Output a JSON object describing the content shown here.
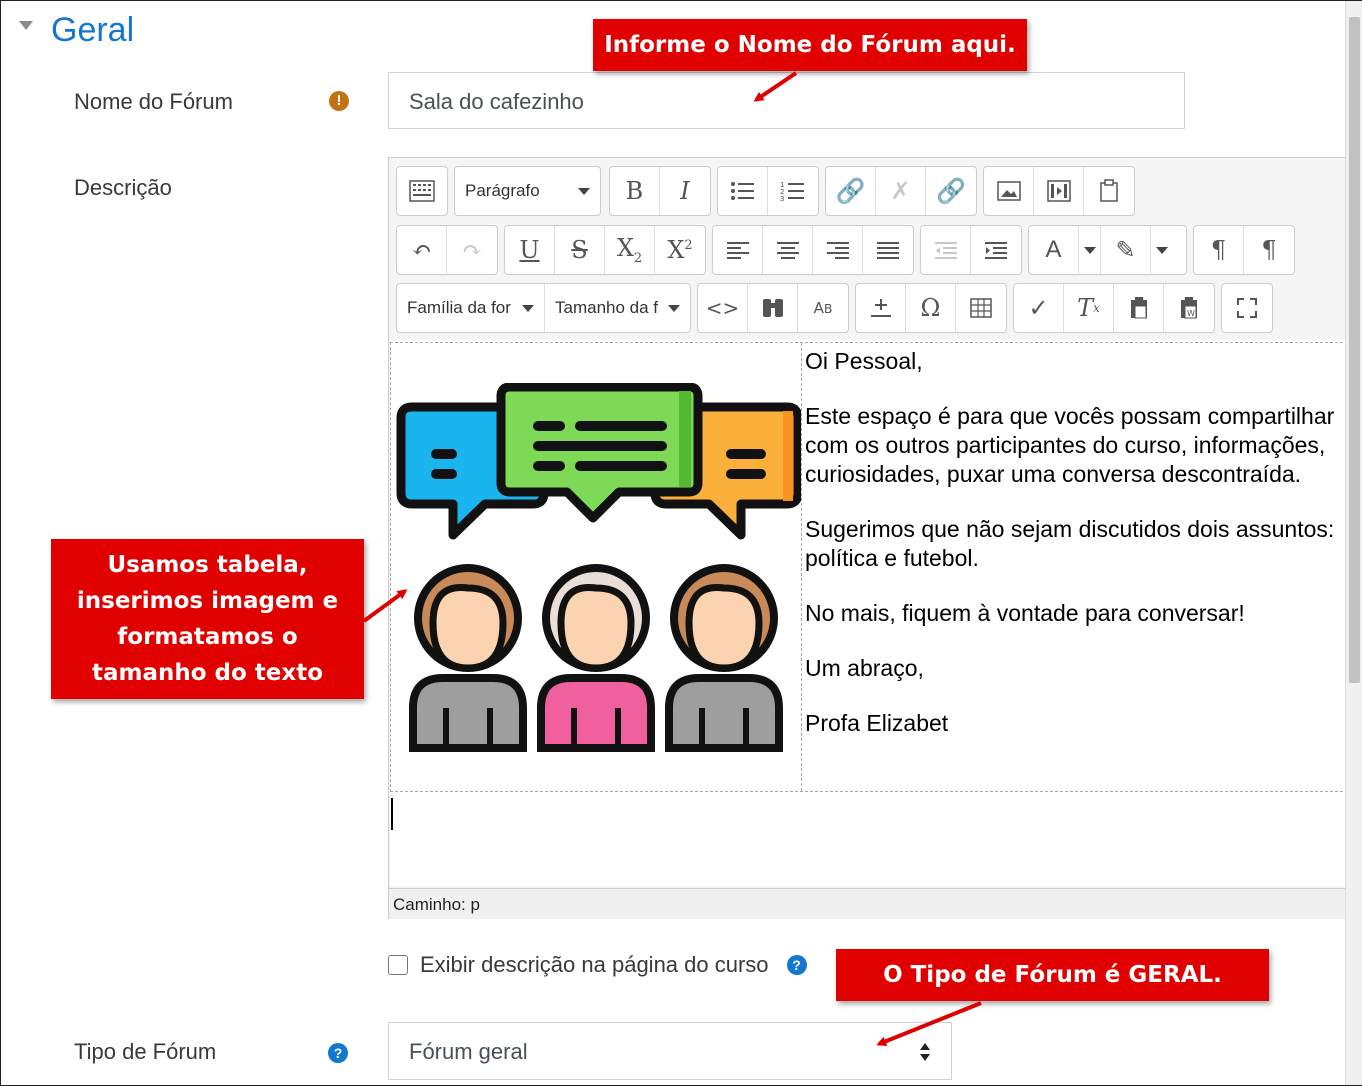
{
  "section": {
    "title": "Geral"
  },
  "forum_name": {
    "label": "Nome do Fórum",
    "value": "Sala do cafezinho",
    "required_icon": "exclamation-icon"
  },
  "description": {
    "label": "Descrição",
    "toolbar": {
      "paragraph_select": "Parágrafo",
      "font_family_select": "Família da for",
      "font_size_select": "Tamanho da f"
    },
    "content": {
      "lines": [
        "Oi Pessoal,",
        "Este espaço é para que vocês possam compartilhar com os outros participantes  do curso, informações, curiosidades, puxar uma conversa descontraída.",
        "Sugerimos que não sejam discutidos dois assuntos: política e futebol.",
        "No mais, fiquem à vontade para conversar!",
        "Um abraço,",
        "Profa Elizabet"
      ]
    },
    "path": "Caminho: p"
  },
  "show_description": {
    "label": "Exibir descrição na página do curso",
    "checked": false
  },
  "forum_type": {
    "label": "Tipo de Fórum",
    "value": "Fórum geral"
  },
  "callouts": {
    "name": "Informe o Nome do Fórum aqui.",
    "table": [
      "Usamos tabela,",
      "inserimos imagem e",
      "formatamos o",
      "tamanho do texto"
    ],
    "type": "O Tipo de Fórum é GERAL."
  },
  "colors": {
    "accent": "#1177d1",
    "callout": "#e00000",
    "required": "#c17313"
  }
}
